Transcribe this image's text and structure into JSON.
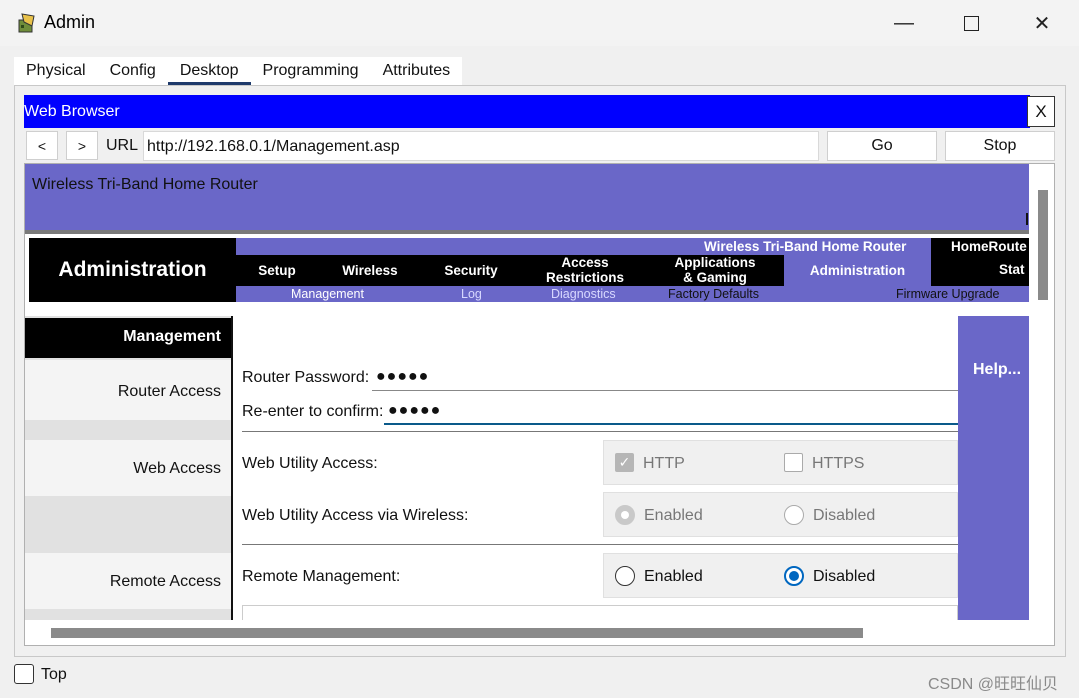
{
  "window": {
    "title": "Admin",
    "minimize_glyph": "—",
    "maximize_glyph": "☐",
    "close_glyph": "✕"
  },
  "tabs": [
    {
      "label": "Physical"
    },
    {
      "label": "Config"
    },
    {
      "label": "Desktop",
      "active": true
    },
    {
      "label": "Programming"
    },
    {
      "label": "Attributes"
    }
  ],
  "browser": {
    "title": "Web Browser",
    "close_label": "X",
    "back_label": "<",
    "forward_label": ">",
    "url_label": "URL",
    "url": "http://192.168.0.1/Management.asp",
    "go_label": "Go",
    "stop_label": "Stop"
  },
  "router": {
    "header_title": "Wireless Tri-Band Home Router",
    "section_title": "Administration",
    "top_strip_text": "Wireless Tri-Band Home Router",
    "home_label": "HomeRoute",
    "status_label": "Stat",
    "menu": [
      {
        "label": "Setup"
      },
      {
        "label": "Wireless"
      },
      {
        "label": "Security"
      },
      {
        "label": "Access Restrictions"
      },
      {
        "label": "Applications & Gaming"
      },
      {
        "label": "Administration",
        "active": true
      }
    ],
    "submenu": [
      {
        "label": "Management",
        "active": true
      },
      {
        "label": "Log"
      },
      {
        "label": "Diagnostics"
      },
      {
        "label": "Factory Defaults"
      },
      {
        "label": "Firmware Upgrade"
      }
    ],
    "left_labels": {
      "management": "Management",
      "router_access": "Router Access",
      "web_access": "Web Access",
      "remote_access": "Remote Access"
    },
    "fields": {
      "router_password_label": "Router Password:",
      "router_password_value": "●●●●●",
      "reenter_label": "Re-enter to confirm:",
      "reenter_value": "●●●●●",
      "web_utility_access_label": "Web Utility Access:",
      "http_label": "HTTP",
      "http_checked": true,
      "https_label": "HTTPS",
      "https_checked": false,
      "web_utility_wireless_label": "Web Utility Access via Wireless:",
      "wireless_enabled_label": "Enabled",
      "wireless_disabled_label": "Disabled",
      "wireless_selected": "Enabled",
      "remote_mgmt_label": "Remote Management:",
      "remote_enabled_label": "Enabled",
      "remote_disabled_label": "Disabled",
      "remote_selected": "Disabled"
    },
    "help_label": "Help..."
  },
  "footer": {
    "top_label": "Top",
    "top_checked": false,
    "watermark": "CSDN @旺旺仙贝"
  }
}
